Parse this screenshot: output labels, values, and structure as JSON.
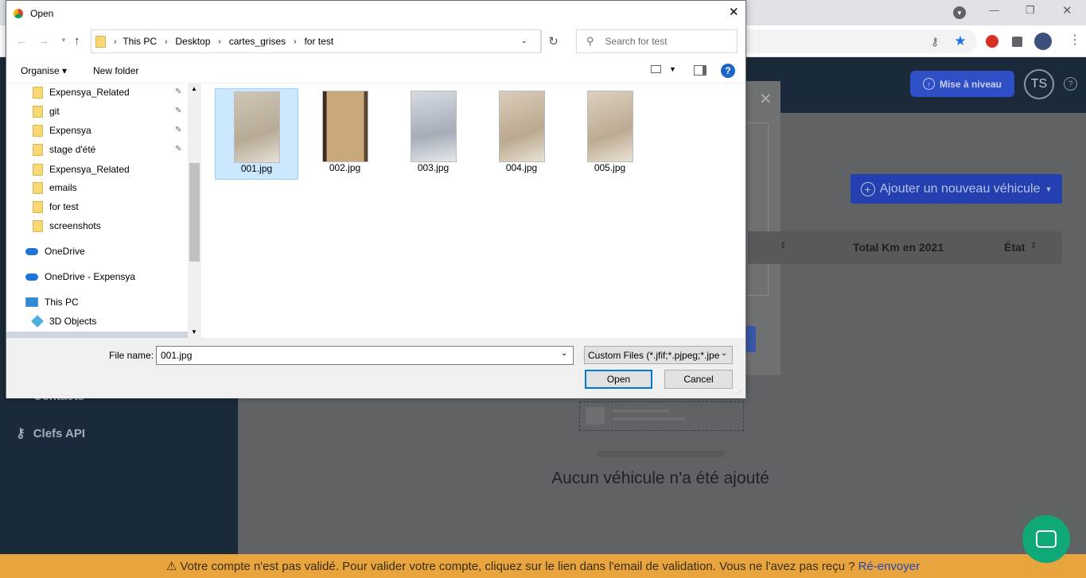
{
  "browser": {
    "window_controls": [
      "—",
      "❐",
      "✕"
    ]
  },
  "app": {
    "upgrade_label": "Mise à niveau",
    "avatar_initials": "TS",
    "help": "?",
    "add_vehicle_label": "Ajouter un nouveau véhicule",
    "table_headers": [
      "Total Km en 2021",
      "État"
    ],
    "sidebar_items": [
      {
        "label": "Contacts"
      },
      {
        "label": "Clefs API"
      }
    ],
    "empty_text": "Aucun véhicule n'a été ajouté",
    "banner_text": "Votre compte n'est pas validé. Pour valider votre compte, cliquez sur le lien dans l'email de validation. Vous ne l'avez pas reçu ?",
    "banner_link": "Ré-envoyer",
    "colors": {
      "sidebar": "#1b2a3a",
      "accent": "#2440b0",
      "banner": "#e8a53e",
      "chat": "#0fa877"
    }
  },
  "dialog": {
    "title": "Open",
    "breadcrumb": [
      "This PC",
      "Desktop",
      "cartes_grises",
      "for test"
    ],
    "search_placeholder": "Search for test",
    "organise_label": "Organise",
    "new_folder_label": "New folder",
    "nav_items": [
      {
        "label": "Expensya_Related",
        "pinned": true
      },
      {
        "label": "git",
        "pinned": true
      },
      {
        "label": "Expensya",
        "pinned": true
      },
      {
        "label": "stage d'été",
        "pinned": true
      },
      {
        "label": "Expensya_Related",
        "pinned": false
      },
      {
        "label": "emails",
        "pinned": false
      },
      {
        "label": "for test",
        "pinned": false
      },
      {
        "label": "screenshots",
        "pinned": false
      }
    ],
    "onedrive": "OneDrive",
    "onedrive_exp": "OneDrive - Expensya",
    "this_pc": "This PC",
    "objects3d": "3D Objects",
    "files": [
      {
        "name": "001.jpg",
        "selected": true
      },
      {
        "name": "002.jpg",
        "selected": false
      },
      {
        "name": "003.jpg",
        "selected": false
      },
      {
        "name": "004.jpg",
        "selected": false
      },
      {
        "name": "005.jpg",
        "selected": false
      }
    ],
    "file_name_label": "File name:",
    "file_name_value": "001.jpg",
    "filter_value": "Custom Files (*.jfif;*.pjpeg;*.jpe",
    "open_label": "Open",
    "cancel_label": "Cancel"
  }
}
